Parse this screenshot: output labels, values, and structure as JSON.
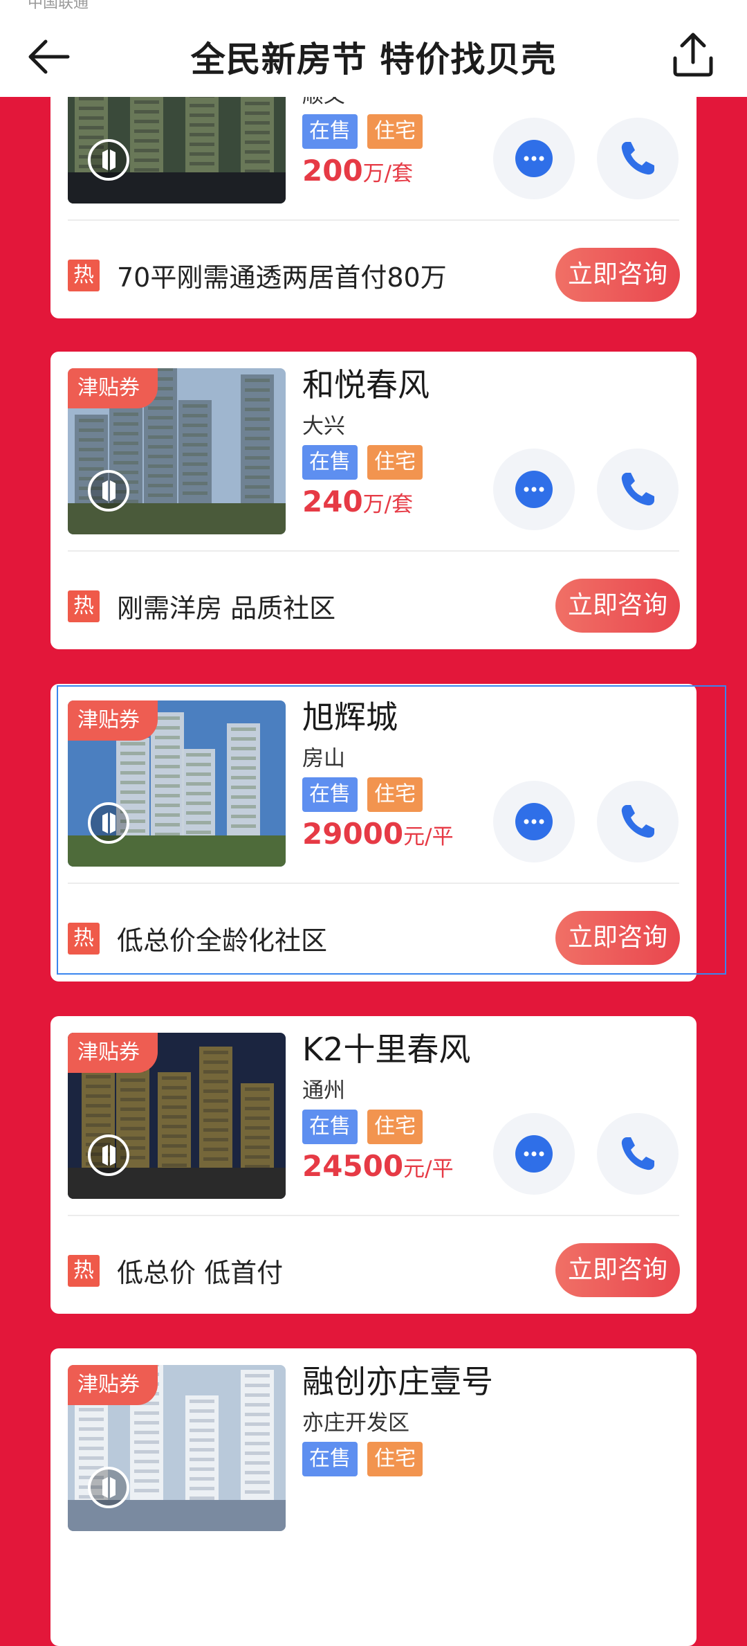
{
  "status_bar": {
    "carrier": "中国联通"
  },
  "header": {
    "title": "全民新房节 特价找贝壳",
    "back_icon": "arrow-left-icon",
    "share_icon": "share-upload-icon"
  },
  "colors": {
    "page_bg": "#e3173a",
    "tag_on_sale": "#5e8ff0",
    "tag_type": "#f2944f",
    "price": "#e63a45",
    "badge": "#ee5d52",
    "icon_blue": "#2f6fe8"
  },
  "listings": [
    {
      "name": "",
      "district": "顺义",
      "badge": "",
      "tags": [
        "在售",
        "住宅"
      ],
      "price_value": "200",
      "price_unit": "万/套",
      "hot_label": "热",
      "slogan": "70平刚需通透两居首付80万",
      "consult_label": "立即咨询",
      "image_icon": "vr-view-icon"
    },
    {
      "name": "和悦春风",
      "district": "大兴",
      "badge": "津贴券",
      "tags": [
        "在售",
        "住宅"
      ],
      "price_value": "240",
      "price_unit": "万/套",
      "hot_label": "热",
      "slogan": "刚需洋房 品质社区",
      "consult_label": "立即咨询",
      "image_icon": "vr-view-icon"
    },
    {
      "name": "旭辉城",
      "district": "房山",
      "badge": "津贴券",
      "tags": [
        "在售",
        "住宅"
      ],
      "price_value": "29000",
      "price_unit": "元/平",
      "hot_label": "热",
      "slogan": "低总价全龄化社区",
      "consult_label": "立即咨询",
      "image_icon": "vr-view-icon"
    },
    {
      "name": "K2十里春风",
      "district": "通州",
      "badge": "津贴券",
      "tags": [
        "在售",
        "住宅"
      ],
      "price_value": "24500",
      "price_unit": "元/平",
      "hot_label": "热",
      "slogan": "低总价 低首付",
      "consult_label": "立即咨询",
      "image_icon": "vr-view-icon"
    },
    {
      "name": "融创亦庄壹号",
      "district": "亦庄开发区",
      "badge": "津贴券",
      "tags": [
        "在售",
        "住宅"
      ],
      "price_value": "",
      "price_unit": "",
      "hot_label": "",
      "slogan": "",
      "consult_label": "",
      "image_icon": "vr-view-icon"
    }
  ]
}
